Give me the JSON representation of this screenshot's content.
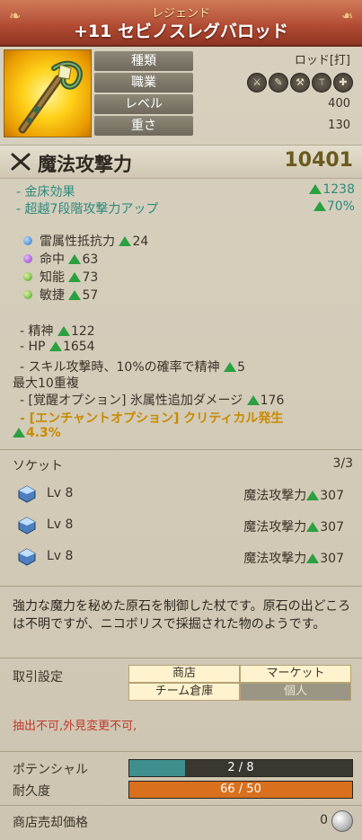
{
  "header": {
    "grade": "レジェンド",
    "name": "+11 セビノスレグバロッド"
  },
  "attributes": {
    "type_label": "種類",
    "type_value": "ロッド[打]",
    "job_label": "職業",
    "job_icons": [
      "sword-icon",
      "wrench-icon",
      "dagger-icon",
      "staff-icon",
      "cross-icon"
    ],
    "level_label": "レベル",
    "level_value": "400",
    "weight_label": "重さ",
    "weight_value": "130"
  },
  "main_stat": {
    "label": "魔法攻撃力",
    "value": "10401"
  },
  "bonuses": [
    {
      "label": "- 金床効果",
      "value": "1238"
    },
    {
      "label": "- 超越7段階攻撃力アップ",
      "value": "70%"
    }
  ],
  "stats": [
    {
      "orb": "blue",
      "label": "雷属性抵抗力",
      "value": "24"
    },
    {
      "orb": "purple",
      "label": "命中",
      "value": "63"
    },
    {
      "orb": "green",
      "label": "知能",
      "value": "73"
    },
    {
      "orb": "green",
      "label": "敏捷",
      "value": "57"
    }
  ],
  "extra": {
    "spirit_label": "- 精神",
    "spirit_value": "122",
    "hp_label": "- HP",
    "hp_value": "1654",
    "skill_text": "- スキル攻撃時、10%の確率で精神",
    "skill_value": "5",
    "stack_text": "最大10重複",
    "awaken_text": "- [覚醒オプション] 氷属性追加ダメージ",
    "awaken_value": "176",
    "enchant_text": "- [エンチャントオプション] クリティカル発生",
    "enchant_value": "4.3%"
  },
  "socket": {
    "label": "ソケット",
    "count": "3/3",
    "items": [
      {
        "lv": "Lv 8",
        "stat": "魔法攻撃力",
        "value": "307"
      },
      {
        "lv": "Lv 8",
        "stat": "魔法攻撃力",
        "value": "307"
      },
      {
        "lv": "Lv 8",
        "stat": "魔法攻撃力",
        "value": "307"
      }
    ]
  },
  "description": "強力な魔力を秘めた原石を制御した杖です。原石の出どころは不明ですが、ニコボリスで採掘された物のようです。",
  "trade": {
    "label": "取引設定",
    "shop": "商店",
    "market": "マーケット",
    "guild": "チーム倉庫",
    "personal": "個人"
  },
  "warning": "抽出不可,外見変更不可,",
  "potential": {
    "label": "ポテンシャル",
    "text": "2 / 8",
    "ratio": 0.25,
    "color": "#3f8f8f"
  },
  "durability": {
    "label": "耐久度",
    "text": "66 / 50",
    "ratio": 1.0,
    "color": "#d8701e"
  },
  "price": {
    "label": "商店売却価格",
    "value": "0"
  }
}
